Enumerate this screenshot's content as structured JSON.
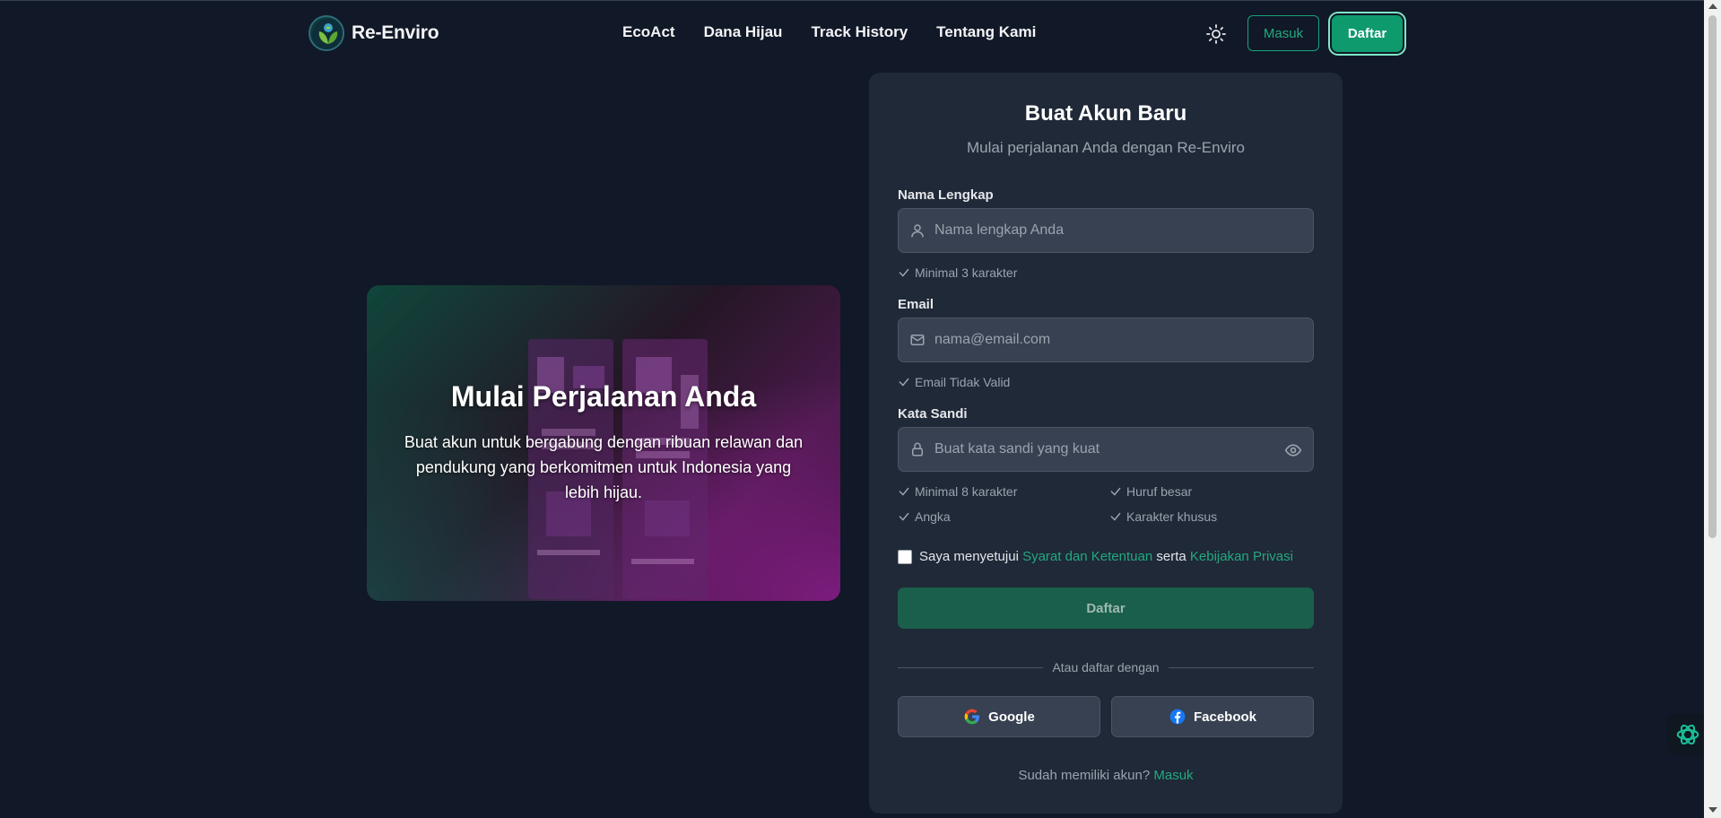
{
  "nav": {
    "brand": "Re-Enviro",
    "links": [
      "EcoAct",
      "Dana Hijau",
      "Track History",
      "Tentang Kami"
    ],
    "theme_icon": "sun-icon",
    "login_label": "Masuk",
    "register_label": "Daftar"
  },
  "hero": {
    "title": "Mulai Perjalanan Anda",
    "description": "Buat akun untuk bergabung dengan ribuan relawan dan pendukung yang berkomitmen untuk Indonesia yang lebih hijau."
  },
  "form": {
    "title": "Buat Akun Baru",
    "subtitle": "Mulai perjalanan Anda dengan Re-Enviro",
    "name": {
      "label": "Nama Lengkap",
      "placeholder": "Nama lengkap Anda",
      "hint": "Minimal 3 karakter"
    },
    "email": {
      "label": "Email",
      "placeholder": "nama@email.com",
      "hint": "Email Tidak Valid"
    },
    "password": {
      "label": "Kata Sandi",
      "placeholder": "Buat kata sandi yang kuat",
      "rules": [
        "Minimal 8 karakter",
        "Huruf besar",
        "Angka",
        "Karakter khusus"
      ]
    },
    "agree": {
      "prefix": "Saya menyetujui",
      "terms": "Syarat dan Ketentuan",
      "middle": "serta",
      "privacy": "Kebijakan Privasi"
    },
    "submit_label": "Daftar",
    "divider_text": "Atau daftar dengan",
    "google_label": "Google",
    "facebook_label": "Facebook",
    "footer_text": "Sudah memiliki akun?",
    "footer_link": "Masuk"
  },
  "colors": {
    "background": "#111827",
    "card": "#1f2937",
    "accent": "#22a97f",
    "button_primary": "#0f9a6e"
  }
}
